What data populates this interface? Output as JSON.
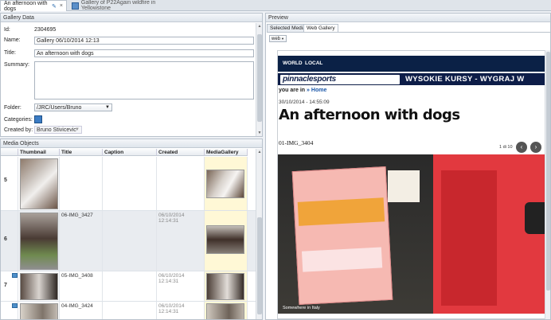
{
  "tabs": [
    {
      "label": "An afternoon with dogs",
      "close": "×"
    },
    {
      "label": "Gallery of P22Again wildfire in Yellowstone"
    }
  ],
  "gallery_data": {
    "header": "Gallery Data",
    "id_label": "Id:",
    "id_value": "2304695",
    "name_label": "Name:",
    "name_value": "Gallery 06/10/2014 12:13",
    "title_label": "Title:",
    "title_value": "An afternoon with dogs",
    "summary_label": "Summary:",
    "folder_label": "Folder:",
    "folder_value": "/JRC/Users/Bruno",
    "categories_label": "Categories:",
    "created_by_label": "Created by:",
    "created_by_value": "Bruno Stivicevic"
  },
  "media": {
    "header": "Media Objects",
    "columns": [
      "Thumbnail",
      "Title",
      "Caption",
      "Created",
      "MediaGallery"
    ],
    "rows": [
      {
        "num": "5",
        "title": "",
        "created": ""
      },
      {
        "num": "6",
        "title": "06-IMG_3427",
        "created": "06/10/2014 12:14:31"
      },
      {
        "num": "7",
        "title": "05-IMG_3408",
        "created": "06/10/2014 12:14:31"
      },
      {
        "num": "",
        "title": "04-IMG_3424",
        "created": "06/10/2014 12:14:31"
      }
    ]
  },
  "preview": {
    "header": "Preview",
    "tabs": [
      "Selected Media",
      "Web Gallery"
    ],
    "dropdown": "web",
    "nav": [
      "WORLD",
      "LOCAL"
    ],
    "logo": "pinnaclesports",
    "ad": "WYSOKIE KURSY - WYGRAJ W",
    "crumb_prefix": "you are in",
    "crumb_sep": "»",
    "crumb_home": "Home",
    "date": "30/10/2014 - 14:55:09",
    "headline": "An afternoon with dogs",
    "image_name": "01-IMG_3404",
    "counter": "1 di 10",
    "prev": "‹",
    "next": "›",
    "caption": "Somewhere in Italy"
  }
}
